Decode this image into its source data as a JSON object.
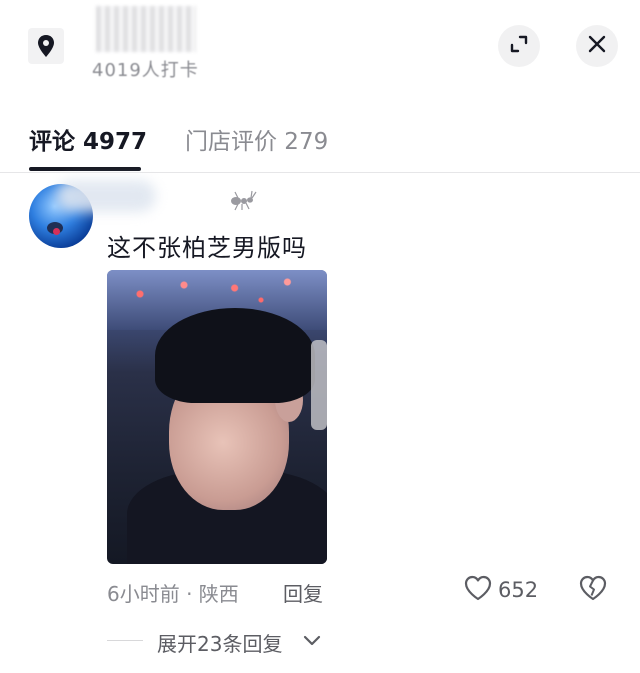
{
  "header": {
    "checkin_text": "4019人打卡"
  },
  "tabs": [
    {
      "label": "评论 4977",
      "active": true
    },
    {
      "label": "门店评价 279",
      "active": false
    }
  ],
  "comment": {
    "text": "这不张柏芝男版吗",
    "time_location": "6小时前 · 陕西",
    "reply_label": "回复",
    "like_count": "652",
    "expand_replies_label": "展开23条回复"
  },
  "colors": {
    "text_primary": "#161823",
    "text_secondary": "#8a8b91",
    "button_bg": "#f1f1f2"
  },
  "icons": [
    "location-pin-icon",
    "expand-icon",
    "close-icon",
    "ant-icon",
    "heart-icon",
    "broken-heart-icon",
    "chevron-down-icon"
  ]
}
